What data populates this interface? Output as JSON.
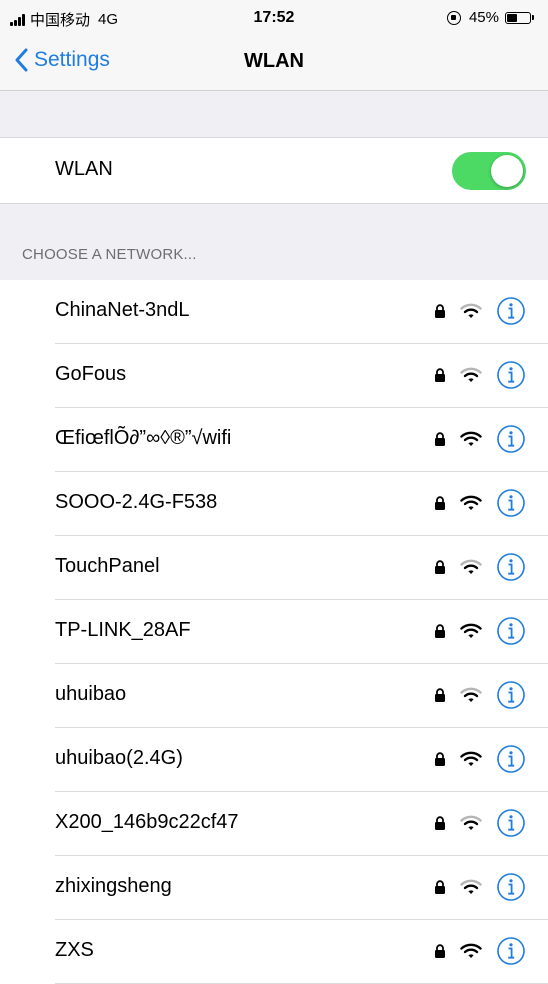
{
  "status_bar": {
    "carrier": "中国移动",
    "network": "4G",
    "time": "17:52",
    "battery_percent": "45%",
    "battery_level": 0.45
  },
  "nav": {
    "back_label": "Settings",
    "title": "WLAN"
  },
  "wlan_toggle": {
    "label": "WLAN",
    "on": true,
    "color": "#4cd964"
  },
  "section_header": "CHOOSE A NETWORK...",
  "networks": [
    {
      "name": "ChinaNet-3ndL",
      "locked": true,
      "signal": "weak"
    },
    {
      "name": "GoFous",
      "locked": true,
      "signal": "weak"
    },
    {
      "name": "ŒfiœflÕ∂”∞◊®”√wifi",
      "locked": true,
      "signal": "strong"
    },
    {
      "name": "SOOO-2.4G-F538",
      "locked": true,
      "signal": "strong"
    },
    {
      "name": "TouchPanel",
      "locked": true,
      "signal": "weak"
    },
    {
      "name": "TP-LINK_28AF",
      "locked": true,
      "signal": "strong"
    },
    {
      "name": "uhuibao",
      "locked": true,
      "signal": "weak"
    },
    {
      "name": "uhuibao(2.4G)",
      "locked": true,
      "signal": "strong"
    },
    {
      "name": "X200_146b9c22cf47",
      "locked": true,
      "signal": "weak"
    },
    {
      "name": "zhixingsheng",
      "locked": true,
      "signal": "weak"
    },
    {
      "name": "ZXS",
      "locked": true,
      "signal": "strong"
    }
  ],
  "colors": {
    "accent": "#1f7de0",
    "toggle_on": "#4cd964",
    "grouped_bg": "#efeff4"
  },
  "icons": {
    "back": "chevron-left-icon",
    "lock": "lock-icon",
    "wifi": "wifi-icon",
    "info": "info-icon"
  }
}
